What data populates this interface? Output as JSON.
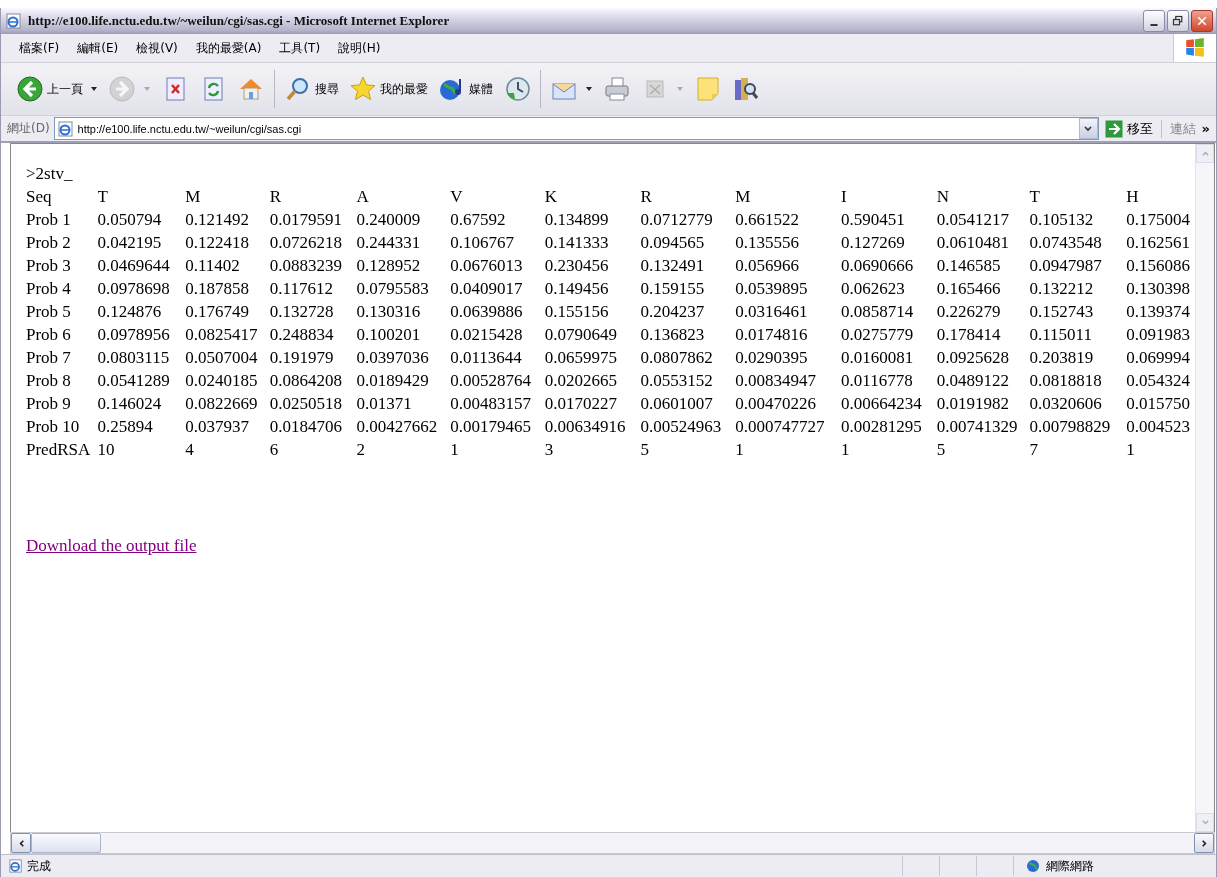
{
  "window": {
    "title": "http://e100.life.nctu.edu.tw/~weilun/cgi/sas.cgi - Microsoft Internet Explorer"
  },
  "menu": [
    "檔案(F)",
    "編輯(E)",
    "檢視(V)",
    "我的最愛(A)",
    "工具(T)",
    "說明(H)"
  ],
  "toolbar": {
    "groups": [
      [
        {
          "kind": "back",
          "label": "上一頁",
          "dropdown": true,
          "disabled": false
        },
        {
          "kind": "forward",
          "dropdown": true,
          "disabled": true
        },
        {
          "kind": "stop",
          "dropdown": false,
          "disabled": false
        },
        {
          "kind": "refresh",
          "dropdown": false,
          "disabled": false
        },
        {
          "kind": "home",
          "dropdown": false,
          "disabled": false
        }
      ],
      [
        {
          "kind": "search",
          "label": "搜尋",
          "dropdown": false,
          "disabled": false
        },
        {
          "kind": "favorites",
          "label": "我的最愛",
          "dropdown": false,
          "disabled": false
        },
        {
          "kind": "media",
          "label": "媒體",
          "dropdown": false,
          "disabled": false
        },
        {
          "kind": "history",
          "dropdown": false,
          "disabled": false
        }
      ],
      [
        {
          "kind": "mail",
          "dropdown": true,
          "disabled": false
        },
        {
          "kind": "print",
          "dropdown": false,
          "disabled": false
        },
        {
          "kind": "edit",
          "dropdown": true,
          "disabled": true
        },
        {
          "kind": "discuss",
          "dropdown": false,
          "disabled": false
        },
        {
          "kind": "research",
          "dropdown": false,
          "disabled": false
        }
      ]
    ]
  },
  "address": {
    "label": "網址(D)",
    "value": "http://e100.life.nctu.edu.tw/~weilun/cgi/sas.cgi",
    "go": "移至",
    "links": "連結",
    "more": "»"
  },
  "content": {
    "heading": ">2stv_",
    "table": {
      "columns": [
        "Seq",
        "T",
        "M",
        "R",
        "A",
        "V",
        "K",
        "R",
        "M",
        "I",
        "N",
        "T",
        "H"
      ],
      "rows": [
        [
          "Prob 1",
          "0.050794",
          "0.121492",
          "0.0179591",
          "0.240009",
          "0.67592",
          "0.134899",
          "0.0712779",
          "0.661522",
          "0.590451",
          "0.0541217",
          "0.105132",
          "0.175004"
        ],
        [
          "Prob 2",
          "0.042195",
          "0.122418",
          "0.0726218",
          "0.244331",
          "0.106767",
          "0.141333",
          "0.094565",
          "0.135556",
          "0.127269",
          "0.0610481",
          "0.0743548",
          "0.162561"
        ],
        [
          "Prob 3",
          "0.0469644",
          "0.11402",
          "0.0883239",
          "0.128952",
          "0.0676013",
          "0.230456",
          "0.132491",
          "0.056966",
          "0.0690666",
          "0.146585",
          "0.0947987",
          "0.156086"
        ],
        [
          "Prob 4",
          "0.0978698",
          "0.187858",
          "0.117612",
          "0.0795583",
          "0.0409017",
          "0.149456",
          "0.159155",
          "0.0539895",
          "0.062623",
          "0.165466",
          "0.132212",
          "0.130398"
        ],
        [
          "Prob 5",
          "0.124876",
          "0.176749",
          "0.132728",
          "0.130316",
          "0.0639886",
          "0.155156",
          "0.204237",
          "0.0316461",
          "0.0858714",
          "0.226279",
          "0.152743",
          "0.139374"
        ],
        [
          "Prob 6",
          "0.0978956",
          "0.0825417",
          "0.248834",
          "0.100201",
          "0.0215428",
          "0.0790649",
          "0.136823",
          "0.0174816",
          "0.0275779",
          "0.178414",
          "0.115011",
          "0.091983"
        ],
        [
          "Prob 7",
          "0.0803115",
          "0.0507004",
          "0.191979",
          "0.0397036",
          "0.0113644",
          "0.0659975",
          "0.0807862",
          "0.0290395",
          "0.0160081",
          "0.0925628",
          "0.203819",
          "0.069994"
        ],
        [
          "Prob 8",
          "0.0541289",
          "0.0240185",
          "0.0864208",
          "0.0189429",
          "0.00528764",
          "0.0202665",
          "0.0553152",
          "0.00834947",
          "0.0116778",
          "0.0489122",
          "0.0818818",
          "0.054324"
        ],
        [
          "Prob 9",
          "0.146024",
          "0.0822669",
          "0.0250518",
          "0.01371",
          "0.00483157",
          "0.0170227",
          "0.0601007",
          "0.00470226",
          "0.00664234",
          "0.0191982",
          "0.0320606",
          "0.015750"
        ],
        [
          "Prob 10",
          "0.25894",
          "0.037937",
          "0.0184706",
          "0.00427662",
          "0.00179465",
          "0.00634916",
          "0.00524963",
          "0.000747727",
          "0.00281295",
          "0.00741329",
          "0.00798829",
          "0.004523"
        ],
        [
          "PredRSA",
          "10",
          "4",
          "6",
          "2",
          "1",
          "3",
          "5",
          "1",
          "1",
          "5",
          "7",
          "1"
        ]
      ]
    },
    "link": "Download the output file"
  },
  "status_bar": {
    "text": "完成",
    "zone": "網際網路"
  }
}
